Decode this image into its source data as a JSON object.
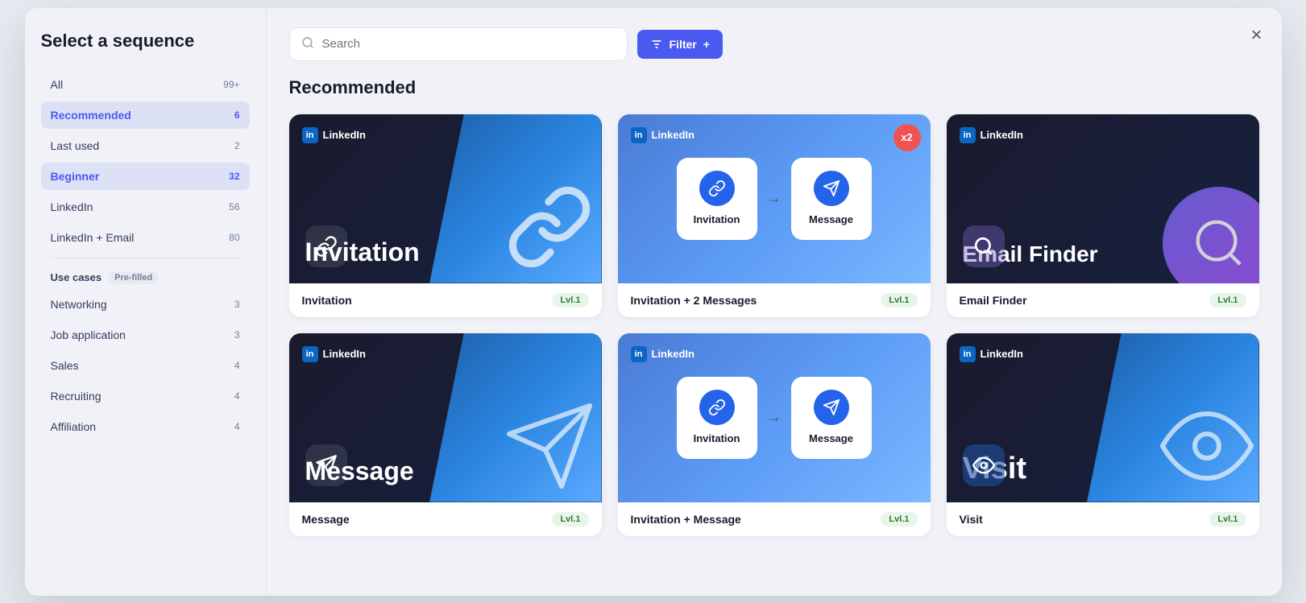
{
  "modal": {
    "title": "Select a sequence",
    "close_label": "×"
  },
  "sidebar": {
    "items": [
      {
        "id": "all",
        "label": "All",
        "count": "99+",
        "active": false
      },
      {
        "id": "recommended",
        "label": "Recommended",
        "count": "6",
        "active": true
      },
      {
        "id": "last-used",
        "label": "Last used",
        "count": "2",
        "active": false
      },
      {
        "id": "beginner",
        "label": "Beginner",
        "count": "32",
        "active": true,
        "secondary": true
      },
      {
        "id": "linkedin",
        "label": "LinkedIn",
        "count": "56",
        "active": false
      },
      {
        "id": "linkedin-email",
        "label": "LinkedIn + Email",
        "count": "80",
        "active": false
      }
    ],
    "use_cases_label": "Use cases",
    "prefilled_badge": "Pre-filled",
    "use_cases": [
      {
        "id": "networking",
        "label": "Networking",
        "count": "3"
      },
      {
        "id": "job-application",
        "label": "Job application",
        "count": "3"
      },
      {
        "id": "sales",
        "label": "Sales",
        "count": "4"
      },
      {
        "id": "recruiting",
        "label": "Recruiting",
        "count": "4"
      },
      {
        "id": "affiliation",
        "label": "Affiliation",
        "count": "4"
      }
    ]
  },
  "search": {
    "placeholder": "Search"
  },
  "filter_btn": {
    "label": "Filter",
    "plus": "+"
  },
  "section": {
    "recommended_label": "Recommended"
  },
  "cards": [
    {
      "id": "invitation",
      "type": "single-dark",
      "title": "Invitation",
      "big_title": "Invitation",
      "level": "Lvl.1",
      "linkedin_label": "LinkedIn",
      "icon": "chain"
    },
    {
      "id": "invitation-2-messages",
      "type": "two-step-blue",
      "title": "Invitation + 2 Messages",
      "level": "Lvl.1",
      "linkedin_label": "LinkedIn",
      "steps": [
        "Invitation",
        "Message"
      ],
      "badge": "x2"
    },
    {
      "id": "email-finder",
      "type": "single-dark-search",
      "title": "Email Finder",
      "big_title": "Email Finder",
      "level": "Lvl.1",
      "linkedin_label": "LinkedIn",
      "icon": "search"
    },
    {
      "id": "message",
      "type": "single-dark-message",
      "title": "Message",
      "big_title": "Message",
      "level": "Lvl.1",
      "linkedin_label": "LinkedIn",
      "icon": "message"
    },
    {
      "id": "invitation-message",
      "type": "two-step-blue-2",
      "title": "Invitation + Message",
      "level": "Lvl.1",
      "linkedin_label": "LinkedIn",
      "steps": [
        "Invitation",
        "Message"
      ]
    },
    {
      "id": "visit",
      "type": "single-dark-visit",
      "title": "Visit",
      "big_title": "Visit",
      "level": "Lvl.1",
      "linkedin_label": "LinkedIn",
      "icon": "eye"
    }
  ],
  "colors": {
    "accent": "#4a5af0",
    "active_bg": "#dde1f5",
    "active_text": "#4a5af0",
    "lvl_bg": "#e8f5e9",
    "lvl_text": "#2e7d32"
  }
}
